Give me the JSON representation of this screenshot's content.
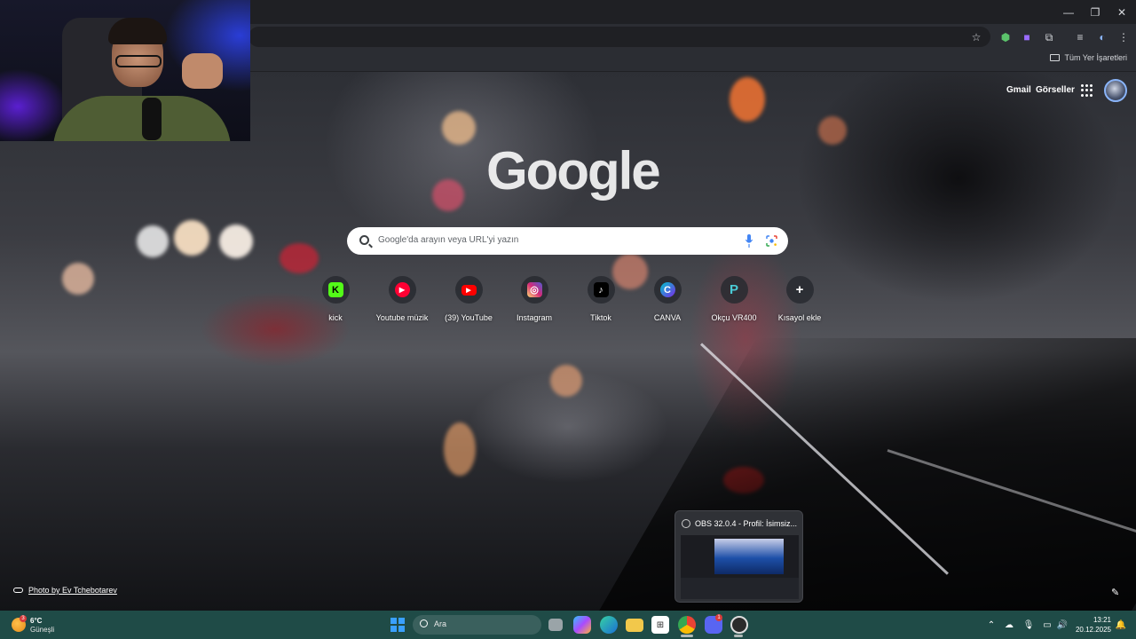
{
  "window": {
    "minimize_glyph": "—",
    "restore_glyph": "❐",
    "close_glyph": "✕"
  },
  "bookmarks_bar": {
    "all_bookmarks_label": "Tüm Yer İşaretleri"
  },
  "ntp": {
    "top_links": {
      "gmail": "Gmail",
      "images": "Görseller"
    },
    "logo_text": "Google",
    "search_placeholder": "Google'da arayın veya URL'yi yazın",
    "shortcuts": [
      {
        "label": "kick",
        "icon": "kick-icon",
        "glyph": "K",
        "color": "#53fc18"
      },
      {
        "label": "Youtube müzik",
        "icon": "youtube-music-icon",
        "glyph": "▶",
        "color": "#ff0033"
      },
      {
        "label": "(39) YouTube",
        "icon": "youtube-icon",
        "glyph": "▶",
        "color": "#ff0000"
      },
      {
        "label": "Instagram",
        "icon": "instagram-icon",
        "glyph": "◎",
        "color": "#d62976"
      },
      {
        "label": "Tiktok",
        "icon": "tiktok-icon",
        "glyph": "♪",
        "color": "#000000"
      },
      {
        "label": "CANVA",
        "icon": "canva-icon",
        "glyph": "C",
        "color": "#7d2ae8"
      },
      {
        "label": "Okçu VR400",
        "icon": "tplink-icon",
        "glyph": "P",
        "color": "#4acbd6"
      },
      {
        "label": "Kısayol ekle",
        "icon": "add-shortcut-icon",
        "glyph": "+",
        "color": "#3c3f45"
      }
    ],
    "photo_credit": "Photo by Ev Tchebotarev"
  },
  "obs_preview": {
    "title": "OBS 32.0.4 - Profil: İsimsiz..."
  },
  "taskbar": {
    "weather": {
      "temp": "6°C",
      "desc": "Güneşli",
      "badge": "3"
    },
    "search_label": "Ara",
    "discord_badge": "1",
    "clock": {
      "time": "13:21",
      "date": "20.12.2025"
    }
  },
  "colors": {
    "taskbar": "#1f4b47",
    "chrome_toolbar": "#2b2d33",
    "accent": "#8ab4f8"
  }
}
